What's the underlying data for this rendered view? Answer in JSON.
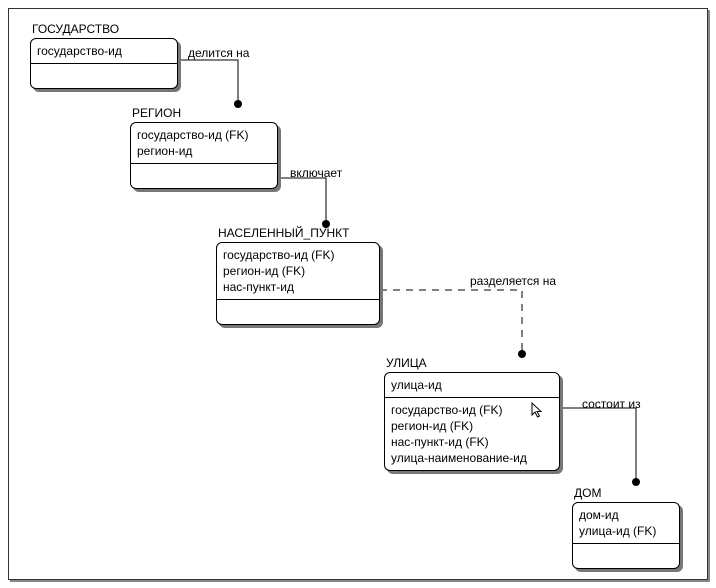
{
  "entities": {
    "state": {
      "title": "ГОСУДАРСТВО",
      "pk": [
        "государство-ид"
      ],
      "attrs": []
    },
    "region": {
      "title": "РЕГИОН",
      "pk": [
        "государство-ид (FK)",
        "регион-ид"
      ],
      "attrs": []
    },
    "settlement": {
      "title": "НАСЕЛЕННЫЙ_ПУНКТ",
      "pk": [
        "государство-ид (FK)",
        "регион-ид (FK)",
        "нас-пункт-ид"
      ],
      "attrs": []
    },
    "street": {
      "title": "УЛИЦА",
      "pk": [
        "улица-ид"
      ],
      "attrs": [
        "государство-ид (FK)",
        "регион-ид (FK)",
        "нас-пункт-ид (FK)",
        "улица-наименование-ид"
      ]
    },
    "house": {
      "title": "ДОМ",
      "pk": [
        "дом-ид",
        "улица-ид (FK)"
      ],
      "attrs": []
    }
  },
  "relationships": {
    "state_region": "делится на",
    "region_settlement": "включает",
    "settlement_street": "разделяется на",
    "street_house": "состоит из"
  }
}
